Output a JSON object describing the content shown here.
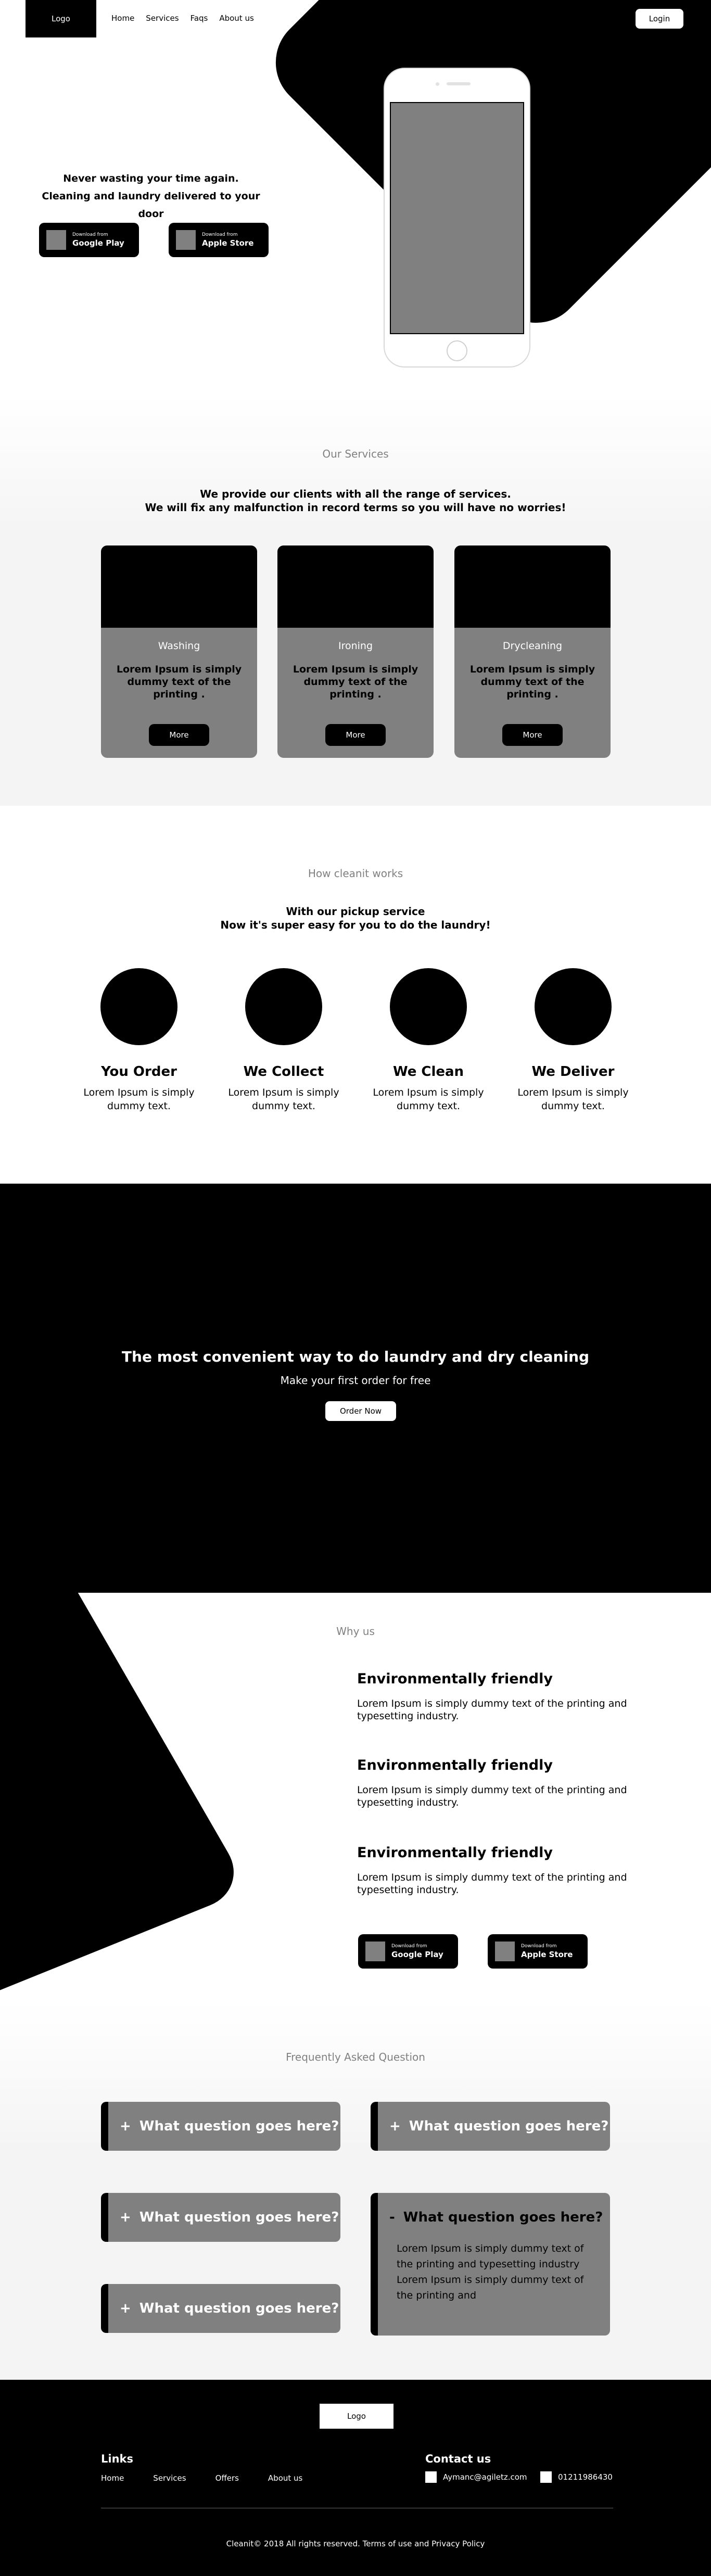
{
  "header": {
    "logo": "Logo",
    "nav": [
      "Home",
      "Services",
      "Faqs",
      "About us"
    ],
    "login": "Login"
  },
  "hero": {
    "line1": "Never wasting your time again.",
    "line2": "Cleaning and laundry delivered to your door",
    "google": {
      "small": "Download from",
      "big": "Google Play"
    },
    "apple": {
      "small": "Download from",
      "big": "Apple Store"
    }
  },
  "services": {
    "label": "Our Services",
    "sub1": "We provide our clients with all the range of services.",
    "sub2": "We will fix any malfunction in record terms so you will have no worries!",
    "cards": [
      {
        "title": "Washing",
        "text": "Lorem Ipsum is simply dummy text of the printing .",
        "button": "More"
      },
      {
        "title": "Ironing",
        "text": "Lorem Ipsum is simply dummy text of the printing .",
        "button": "More"
      },
      {
        "title": "Drycleaning",
        "text": "Lorem Ipsum is simply dummy text of the printing .",
        "button": "More"
      }
    ]
  },
  "how": {
    "label": "How cleanit works",
    "sub1": "With our pickup service",
    "sub2": "Now it's super easy for you to do the laundry!",
    "steps": [
      {
        "title": "You Order",
        "text": "Lorem Ipsum is simply dummy text."
      },
      {
        "title": "We Collect",
        "text": "Lorem Ipsum is simply dummy text."
      },
      {
        "title": "We Clean",
        "text": "Lorem Ipsum is simply dummy text."
      },
      {
        "title": "We Deliver",
        "text": "Lorem Ipsum is simply dummy text."
      }
    ]
  },
  "cta": {
    "title": "The most convenient way to do laundry and dry cleaning",
    "sub": "Make your first order for free",
    "button": "Order Now"
  },
  "why": {
    "label": "Why us",
    "items": [
      {
        "title": "Environmentally friendly",
        "text": "Lorem Ipsum is simply dummy text of the printing and typesetting industry."
      },
      {
        "title": "Environmentally friendly",
        "text": "Lorem Ipsum is simply dummy text of the printing and typesetting industry."
      },
      {
        "title": "Environmentally friendly",
        "text": "Lorem Ipsum is simply dummy text of the printing and typesetting industry."
      }
    ],
    "google": {
      "small": "Download from",
      "big": "Google Play"
    },
    "apple": {
      "small": "Download from",
      "big": "Apple Store"
    }
  },
  "faq": {
    "label": "Frequently Asked Question",
    "items": [
      {
        "symbol": "+",
        "question": "What question goes here?"
      },
      {
        "symbol": "+",
        "question": "What question goes here?"
      },
      {
        "symbol": "+",
        "question": "What question goes here?"
      },
      {
        "symbol": "+",
        "question": "What question goes here?"
      },
      {
        "symbol": "-",
        "question": "What question goes here?",
        "answer": "Lorem Ipsum is simply dummy text of the printing and typesetting industry Lorem Ipsum is simply dummy text of the printing and"
      }
    ]
  },
  "footer": {
    "logo": "Logo",
    "links_title": "Links",
    "links": [
      "Home",
      "Services",
      "Offers",
      "About us"
    ],
    "contact_title": "Contact us",
    "email": "Aymanc@agiletz.com",
    "phone": "01211986430",
    "copyright": "Cleanit© 2018 All rights reserved. Terms of use and Privacy Policy"
  }
}
